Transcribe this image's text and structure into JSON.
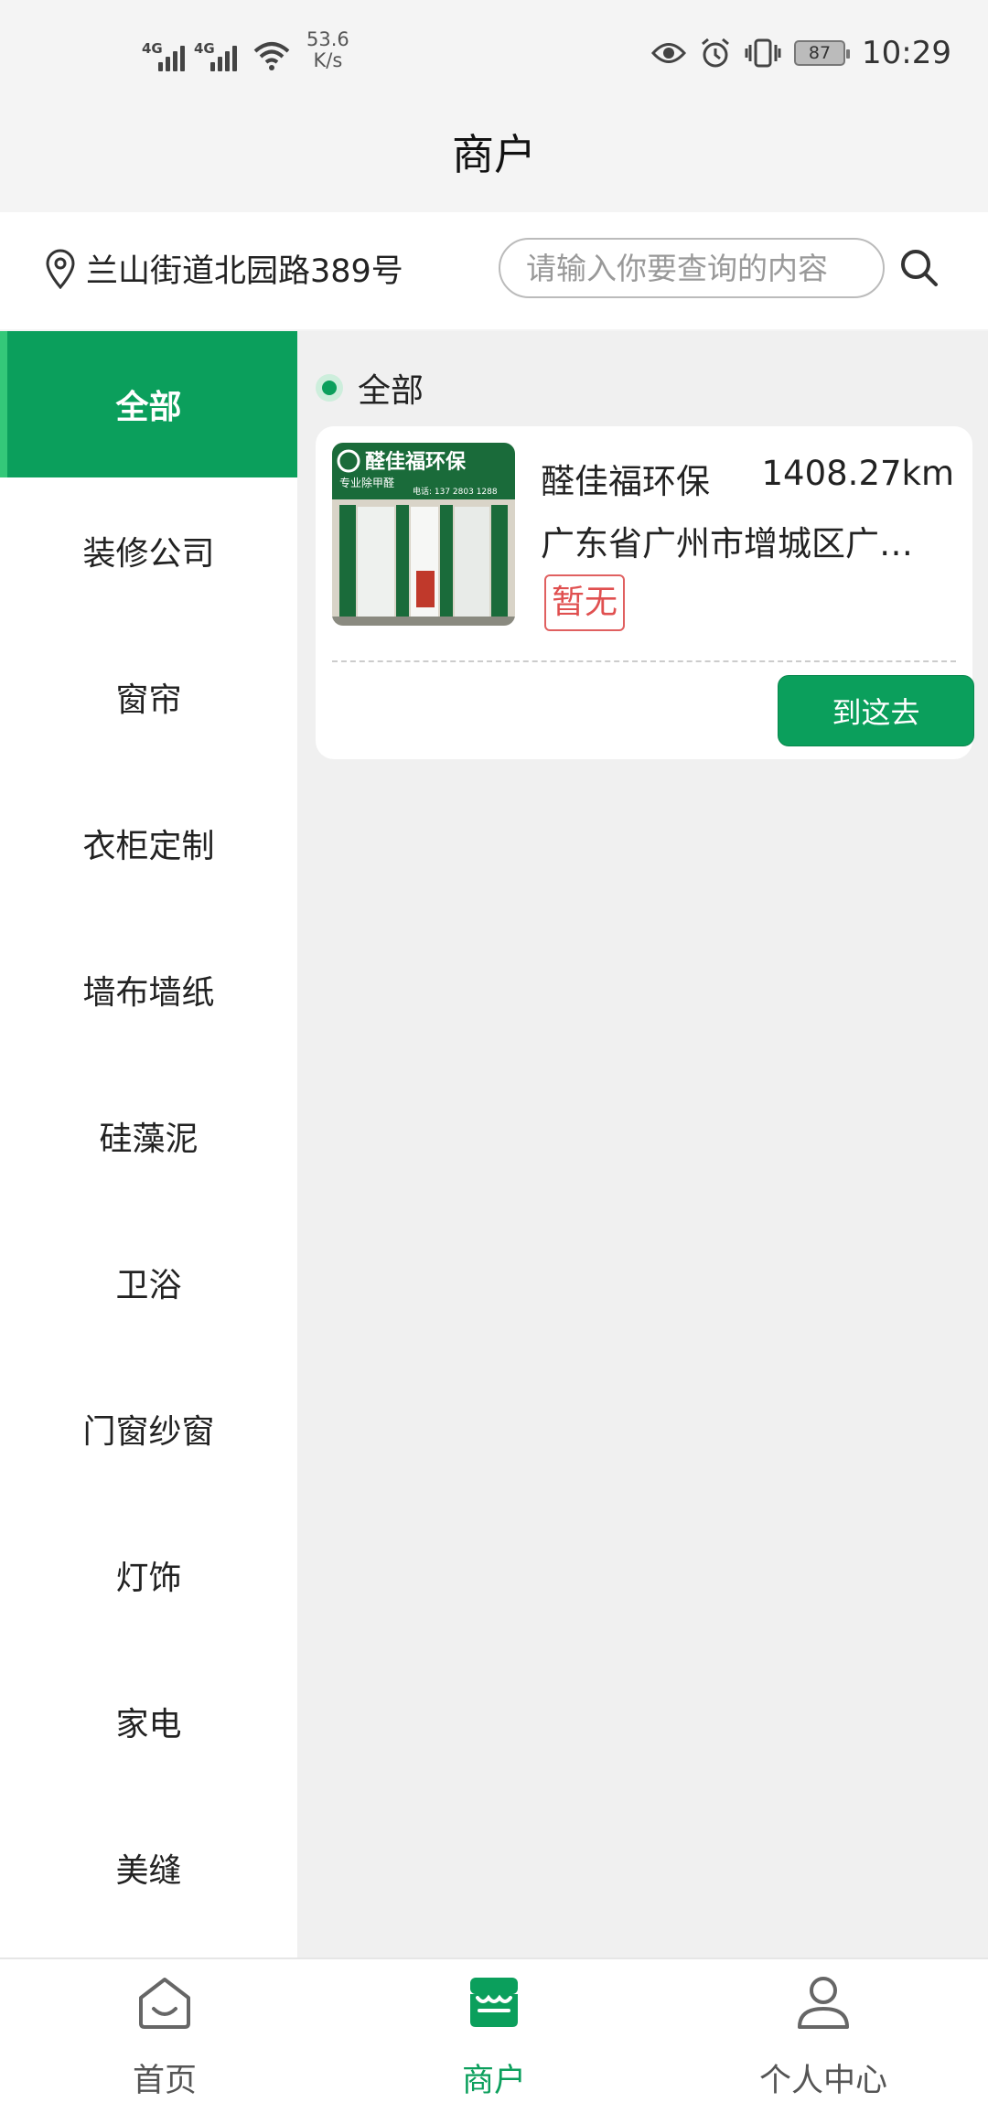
{
  "status_bar": {
    "network_1": "4G",
    "network_2": "4G",
    "speed_value": "53.6",
    "speed_unit": "K/s",
    "battery": "87",
    "time": "10:29"
  },
  "header": {
    "title": "商户"
  },
  "location": {
    "text": "兰山街道北园路389号",
    "icon": "location-pin-icon"
  },
  "search": {
    "placeholder": "请输入你要查询的内容",
    "icon": "search-icon"
  },
  "categories": [
    {
      "label": "全部",
      "active": true
    },
    {
      "label": "装修公司"
    },
    {
      "label": "窗帘"
    },
    {
      "label": "衣柜定制"
    },
    {
      "label": "墙布墙纸"
    },
    {
      "label": "硅藻泥"
    },
    {
      "label": "卫浴"
    },
    {
      "label": "门窗纱窗"
    },
    {
      "label": "灯饰"
    },
    {
      "label": "家电"
    },
    {
      "label": "美缝"
    }
  ],
  "content": {
    "section_title": "全部",
    "merchants": [
      {
        "name": "醛佳福环保",
        "distance": "1408.27km",
        "address": "广东省广州市增城区广…",
        "tag": "暂无",
        "action_label": "到这去",
        "sign_main": "醛佳福环保",
        "sign_sub": "专业除甲醛",
        "sign_phone": "电话: 137 2803 1288"
      }
    ]
  },
  "bottom_nav": [
    {
      "label": "首页",
      "icon": "home-icon",
      "active": false
    },
    {
      "label": "商户",
      "icon": "store-icon",
      "active": true
    },
    {
      "label": "个人中心",
      "icon": "user-icon",
      "active": false
    }
  ],
  "colors": {
    "primary": "#0b9f5c",
    "tag_red": "#e05050",
    "background": "#f0f0f0"
  }
}
